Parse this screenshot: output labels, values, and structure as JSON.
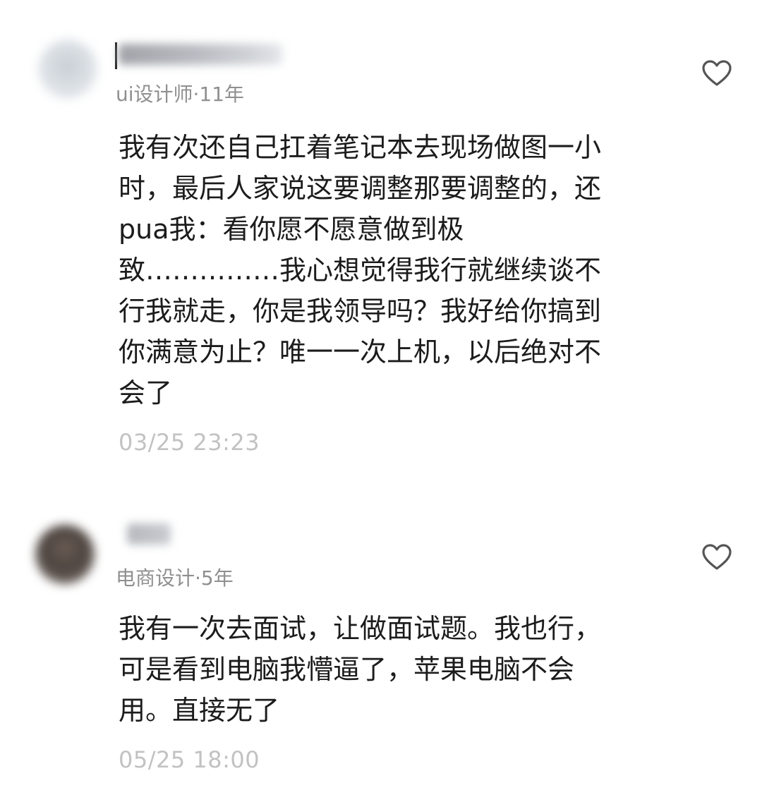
{
  "comments": [
    {
      "author_meta": "ui设计师·11年",
      "lines": [
        "我有次还自己扛着笔记本去现场做图一小",
        "时，最后人家说这要调整那要调整的，还",
        "pua我：看你愿不愿意做到极",
        "致……………我心想觉得我行就继续谈不",
        "行我就走，你是我领导吗？我好给你搞到",
        "你满意为止？唯一一次上机，以后绝对不",
        "会了"
      ],
      "timestamp": "03/25 23:23",
      "like_icon": "heart-outline-icon"
    },
    {
      "author_meta": "电商设计·5年",
      "lines": [
        "我有一次去面试，让做面试题。我也行，",
        "可是看到电脑我懵逼了，苹果电脑不会",
        "用。直接无了"
      ],
      "timestamp": "05/25 18:00",
      "like_icon": "heart-outline-icon"
    }
  ],
  "colors": {
    "text": "#1c1c1c",
    "meta": "#8f8f8f",
    "timestamp": "#c2c2c2",
    "icon": "#555555"
  }
}
